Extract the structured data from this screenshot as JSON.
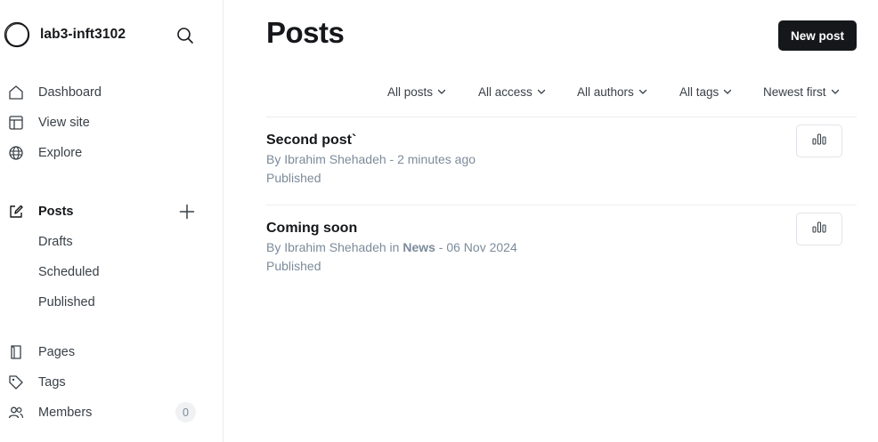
{
  "site": {
    "name": "lab3-inft3102"
  },
  "sidebar": {
    "top_items": [
      {
        "label": "Dashboard",
        "icon": "home-icon"
      },
      {
        "label": "View site",
        "icon": "layout-icon"
      },
      {
        "label": "Explore",
        "icon": "globe-icon"
      }
    ],
    "posts": {
      "label": "Posts",
      "icon": "edit-icon",
      "sub_items": [
        {
          "label": "Drafts"
        },
        {
          "label": "Scheduled"
        },
        {
          "label": "Published"
        }
      ]
    },
    "bottom_items": [
      {
        "label": "Pages",
        "icon": "page-icon"
      },
      {
        "label": "Tags",
        "icon": "tag-icon"
      },
      {
        "label": "Members",
        "icon": "members-icon",
        "count": "0"
      }
    ]
  },
  "header": {
    "title": "Posts",
    "new_post_label": "New post"
  },
  "filters": [
    {
      "label": "All posts"
    },
    {
      "label": "All access"
    },
    {
      "label": "All authors"
    },
    {
      "label": "All tags"
    },
    {
      "label": "Newest first"
    }
  ],
  "posts": [
    {
      "title": "Second post`",
      "meta_prefix": "By Ibrahim Shehadeh - 2 minutes ago",
      "status": "Published"
    },
    {
      "title": "Coming soon",
      "meta_by": "By Ibrahim Shehadeh in",
      "meta_tag": "News",
      "meta_date": "- 06 Nov 2024",
      "status": "Published"
    }
  ],
  "colors": {
    "primary_text": "#15171a",
    "secondary_text": "#7c8b9a",
    "button_bg": "#15171a",
    "divider": "#ebeef0"
  }
}
